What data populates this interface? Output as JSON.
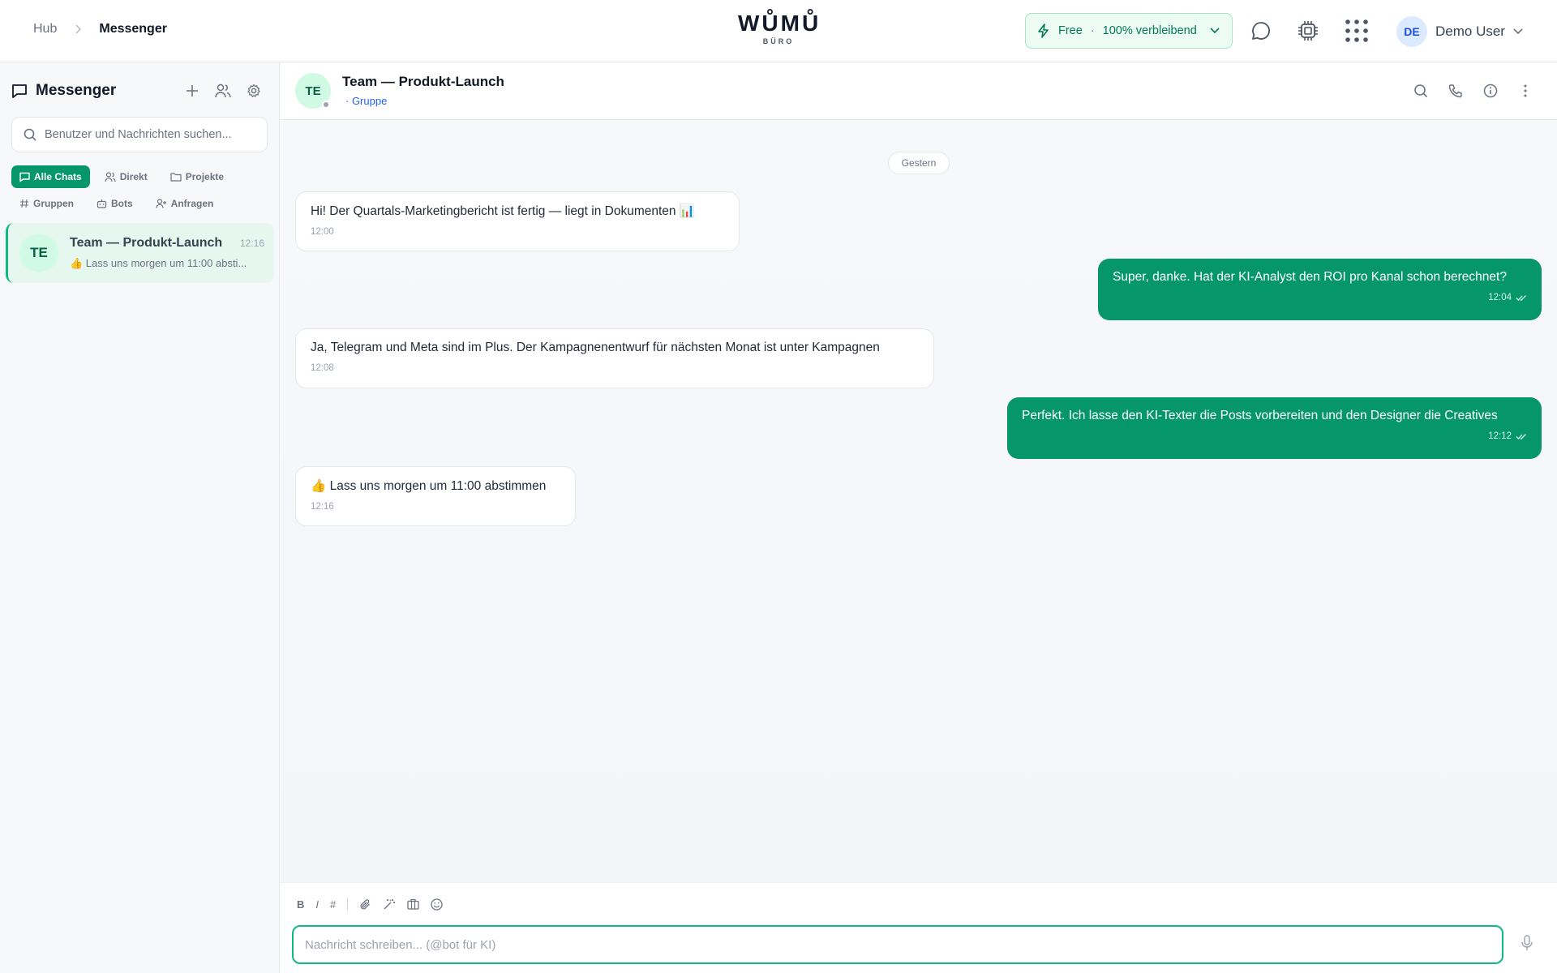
{
  "topbar": {
    "breadcrumb": {
      "hub": "Hub",
      "current": "Messenger"
    },
    "logo": {
      "main": "WŮMŮ",
      "sub": "BÜRO"
    },
    "plan": {
      "tier": "Free",
      "separator": "·",
      "remaining": "100% verbleibend"
    },
    "user": {
      "initials": "DE",
      "name": "Demo User"
    }
  },
  "sidebar": {
    "title": "Messenger",
    "search_placeholder": "Benutzer und Nachrichten suchen...",
    "filters": [
      {
        "label": "Alle Chats",
        "icon": "chat-icon",
        "active": true
      },
      {
        "label": "Direkt",
        "icon": "users-icon",
        "active": false
      },
      {
        "label": "Projekte",
        "icon": "folder-icon",
        "active": false
      },
      {
        "label": "Gruppen",
        "icon": "hash-icon",
        "active": false
      },
      {
        "label": "Bots",
        "icon": "bot-icon",
        "active": false
      },
      {
        "label": "Anfragen",
        "icon": "user-plus-icon",
        "active": false
      }
    ],
    "chats": [
      {
        "initials": "TE",
        "name": "Team — Produkt-Launch",
        "time": "12:16",
        "preview": "👍 Lass uns morgen um 11:00 absti..."
      }
    ]
  },
  "chat": {
    "initials": "TE",
    "title": "Team — Produkt-Launch",
    "subtitle": "· Gruppe",
    "date_divider": "Gestern",
    "messages": [
      {
        "direction": "in",
        "text": "Hi! Der Quartals-Marketingbericht ist fertig — liegt in Dokumenten 📊",
        "time": "12:00"
      },
      {
        "direction": "out",
        "text": "Super, danke. Hat der KI-Analyst den ROI pro Kanal schon berechnet?",
        "time": "12:04"
      },
      {
        "direction": "in",
        "text": "Ja, Telegram und Meta sind im Plus. Der Kampagnenentwurf für nächsten Monat ist unter Kampagnen",
        "time": "12:08"
      },
      {
        "direction": "out",
        "text": "Perfekt. Ich lasse den KI-Texter die Posts vorbereiten und den Designer die Creatives",
        "time": "12:12"
      },
      {
        "direction": "in",
        "text": "👍 Lass uns morgen um 11:00 abstimmen",
        "time": "12:16"
      }
    ]
  },
  "composer": {
    "bold": "B",
    "italic": "I",
    "hash": "#",
    "placeholder": "Nachricht schreiben... (@bot für KI)"
  },
  "colors": {
    "accent": "#059669",
    "accent_light": "#e6f7ef",
    "link": "#2563eb"
  }
}
